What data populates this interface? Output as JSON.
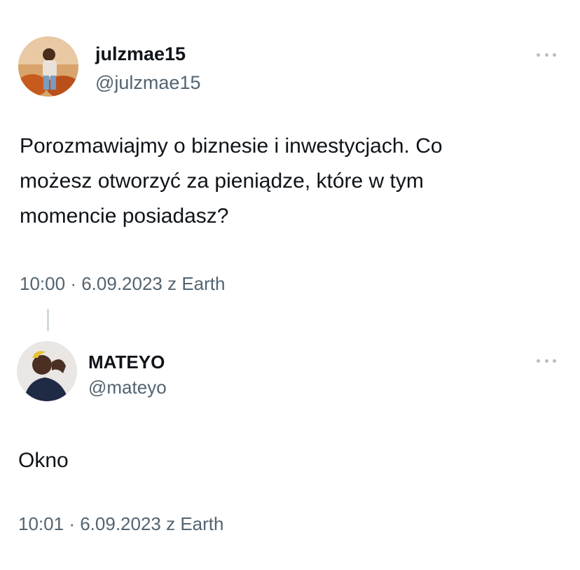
{
  "tweet1": {
    "display_name": "julzmae15",
    "handle": "@julzmae15",
    "text": "Porozmawiajmy o biznesie i inwestycjach. Co\nmożesz otworzyć za pieniądze, które w tym\nmomencie posiadasz?",
    "time": "10:00",
    "separator": "·",
    "date_source": "6.09.2023 z Earth",
    "avatar_icon": "user-photo-avatar",
    "more_icon": "more-dots-icon"
  },
  "tweet2": {
    "display_name": "MATEYO",
    "handle": "@mateyo",
    "text": "Okno",
    "time": "10:01",
    "separator": "·",
    "date_source": "6.09.2023 z Earth",
    "avatar_icon": "user-photo-avatar",
    "more_icon": "more-dots-icon"
  },
  "colors": {
    "text_primary": "#0f1419",
    "text_secondary": "#536471",
    "dots": "#b6bdc3",
    "thread_line": "#cfd9de",
    "background": "#ffffff"
  }
}
